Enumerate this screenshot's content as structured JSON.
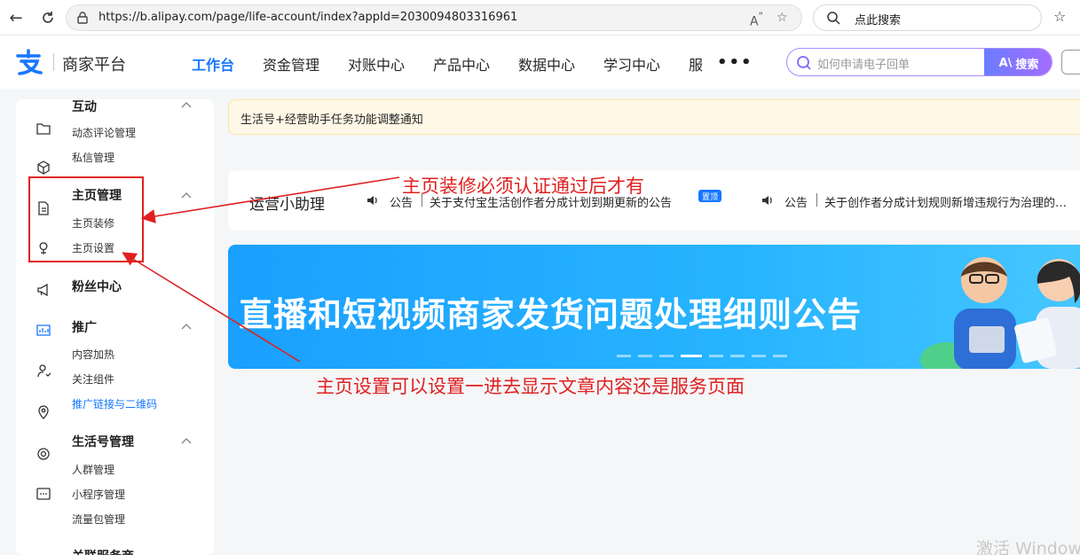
{
  "browser": {
    "url": "https://b.alipay.com/page/life-account/index?appId=2030094803316961",
    "search_placeholder": "点此搜索"
  },
  "header": {
    "brand": "商家平台",
    "nav": [
      "工作台",
      "资金管理",
      "对账中心",
      "产品中心",
      "数据中心",
      "学习中心",
      "服"
    ],
    "more": "•••",
    "search_placeholder": "如何申请电子回单",
    "search_button": "搜索"
  },
  "sidebar": {
    "groups": [
      {
        "title": "互动",
        "items": [
          "动态评论管理",
          "私信管理"
        ]
      },
      {
        "title": "主页管理",
        "items": [
          "主页装修",
          "主页设置"
        ]
      },
      {
        "title": "粉丝中心",
        "items": []
      },
      {
        "title": "推广",
        "items": [
          "内容加热",
          "关注组件",
          "推广链接与二维码"
        ]
      },
      {
        "title": "生活号管理",
        "items": [
          "人群管理",
          "小程序管理",
          "流量包管理"
        ]
      },
      {
        "title": "关联服务商",
        "items": []
      }
    ]
  },
  "notice": "生活号+经营助手任务功能调整通知",
  "assistant": {
    "title": "运营小助理",
    "announcements": [
      {
        "tag": "公告",
        "text": "关于支付宝生活创作者分成计划到期更新的公告",
        "badge": "置顶"
      },
      {
        "tag": "公告",
        "text": "关于创作者分成计划规则新增违规行为治理的…"
      }
    ]
  },
  "banner": {
    "text": "直播和短视频商家发货问题处理细则公告",
    "active_slide": 4,
    "slide_count": 8
  },
  "annotations": {
    "note1": "主页装修必须认证通过后才有",
    "note2": "主页设置可以设置一进去显示文章内容还是服务页面"
  },
  "watermark": "激活 Window",
  "colors": {
    "accent": "#1677ff",
    "annotation": "#e02020",
    "banner": "#1aa0ff"
  }
}
